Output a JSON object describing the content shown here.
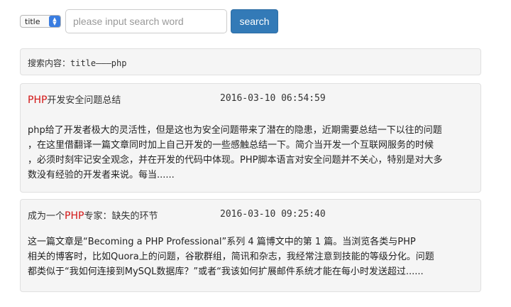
{
  "search": {
    "field_selected": "title",
    "placeholder": "please input search word",
    "button_label": "search"
  },
  "query": {
    "text": "搜索内容：title———php"
  },
  "results": [
    {
      "title_pre": "",
      "title_highlight": "PHP",
      "title_post": "开发安全问题总结",
      "date": "2016-03-10 06:54:59",
      "lines": [
        "php给了开发者极大的灵活性，但是这也为安全问题带来了潜在的隐患，近期需要总结一下以往的问题",
        "，在这里借翻译一篇文章同时加上自己开发的一些感触总结一下。简介当开发一个互联网服务的时候",
        "，必须时刻牢记安全观念，并在开发的代码中体现。PHP脚本语言对安全问题并不关心，特别是对大多",
        "数没有经验的开发者来说。每当......"
      ]
    },
    {
      "title_pre": "成为一个",
      "title_highlight": "PHP",
      "title_post": "专家：缺失的环节",
      "date": "2016-03-10 09:25:40",
      "lines": [
        "这一篇文章是“Becoming a PHP Professional”系列 4 篇博文中的第 1 篇。当浏览各类与PHP",
        "相关的博客时，比如Quora上的问题，谷歌群组，简讯和杂志，我经常注意到技能的等级分化。问题",
        "都类似于“我如何连接到MySQL数据库？”或者“我该如何扩展邮件系统才能在每小时发送超过......"
      ]
    }
  ]
}
